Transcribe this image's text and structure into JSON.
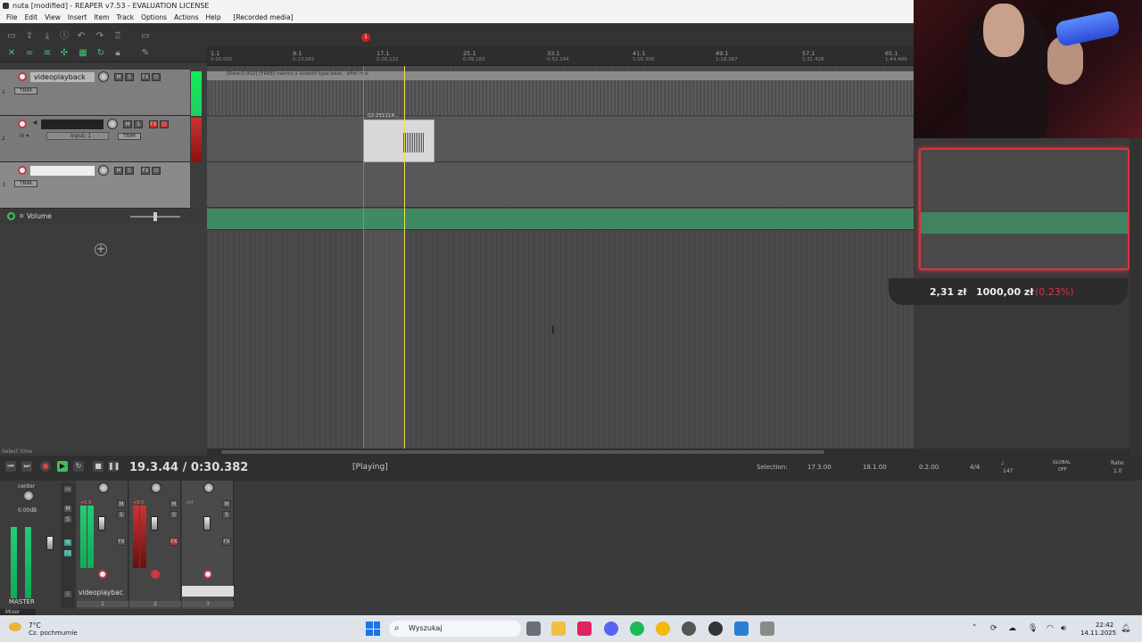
{
  "window": {
    "title": "nuta [modified] - REAPER v7.53 - EVALUATION LICENSE"
  },
  "menu": [
    "File",
    "Edit",
    "View",
    "Insert",
    "Item",
    "Track",
    "Options",
    "Actions",
    "Help",
    "[Recorded media]"
  ],
  "ruler": {
    "marks": [
      {
        "bar": "1.1",
        "time": "0:00.000"
      },
      {
        "bar": "9.1",
        "time": "0:13.061"
      },
      {
        "bar": "17.1",
        "time": "0:26.122"
      },
      {
        "bar": "25.1",
        "time": "0:39.183"
      },
      {
        "bar": "33.1",
        "time": "0:52.244"
      },
      {
        "bar": "41.1",
        "time": "1:05.306"
      },
      {
        "bar": "49.1",
        "time": "1:18.367"
      },
      {
        "bar": "57.1",
        "time": "1:31.428"
      },
      {
        "bar": "65.1",
        "time": "1:44.489"
      }
    ],
    "marker_label": "1"
  },
  "tracks": [
    {
      "num": "1",
      "name": "videoplayback",
      "trim": "TRIM"
    },
    {
      "num": "2",
      "name": "",
      "input": "Input: 1",
      "trim": "TRIM"
    },
    {
      "num": "3",
      "name": "",
      "trim": "TRIM"
    }
  ],
  "items": {
    "item1_label": "[Rate:0.902] [FREE] namco x kidwild type beat - affer mix",
    "item2_label": "02-251114..."
  },
  "envelope": {
    "label": "Volume"
  },
  "transport": {
    "time": "19.3.44 / 0:30.382",
    "status": "[Playing]",
    "selection_label": "Selection:",
    "sel_start": "17.3.00",
    "sel_end": "18.1.00",
    "sel_length": "0.2.00",
    "time_sig": "4/4",
    "bpm": "147",
    "global_label": "GLOBAL",
    "global_state": "OFF",
    "rate_label": "Rate:",
    "rate_value": "1.0",
    "select_time": "Select time"
  },
  "mixer": {
    "master_pan": "center",
    "master_db": "0.00dB",
    "master_label": "MASTER",
    "tab_label": "Mixer",
    "strips": [
      {
        "name": "videoplaybac",
        "num": "1",
        "peak": "+5.9"
      },
      {
        "name": "",
        "num": "2",
        "peak": "+8.0"
      },
      {
        "name": "",
        "num": "3",
        "peak": "-inf"
      }
    ]
  },
  "stream_overlay": {
    "current": "2,31 zł",
    "goal": "1000,00 zł",
    "percent": "(0.23%)"
  },
  "taskbar": {
    "weather_temp": "7°C",
    "weather_desc": "Cz. pochmurnie",
    "search_placeholder": "Wyszukaj",
    "clock_time": "22:42",
    "clock_date": "14.11.2025"
  },
  "colors": {
    "accent_green": "#3f8a63",
    "record_red": "#e23040",
    "play_cursor": "#f0e050"
  }
}
